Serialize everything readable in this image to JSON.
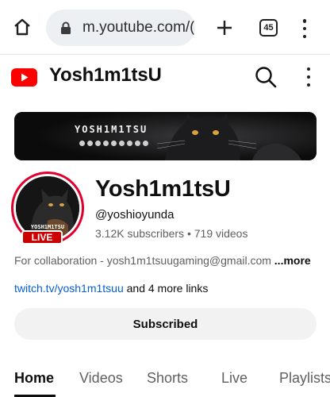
{
  "browser": {
    "url": "m.youtube.com/(",
    "tab_count": "45"
  },
  "header": {
    "title": "Yosh1m1tsU"
  },
  "banner": {
    "name": "YOSH1M1TSU"
  },
  "channel": {
    "avatar_text": "YOSH1M1TSU",
    "live_label": "LIVE",
    "name": "Yosh1m1tsU",
    "handle": "@yoshioyunda",
    "subscribers": "3.12K subscribers",
    "separator": " • ",
    "videos": "719 videos",
    "description": "For collaboration - yosh1m1tsuugaming@gmail.com ",
    "more_label": "...more",
    "link_primary": "twitch.tv/yosh1m1tsuu",
    "link_more": " and 4 more links",
    "subscribe_label": "Subscribed"
  },
  "tabs": [
    {
      "label": "Home"
    },
    {
      "label": "Videos"
    },
    {
      "label": "Shorts"
    },
    {
      "label": "Live"
    },
    {
      "label": "Playlists"
    }
  ],
  "colors": {
    "brand_red": "#ff0000",
    "live_red": "#cc0000",
    "link_blue": "#065fd4"
  }
}
